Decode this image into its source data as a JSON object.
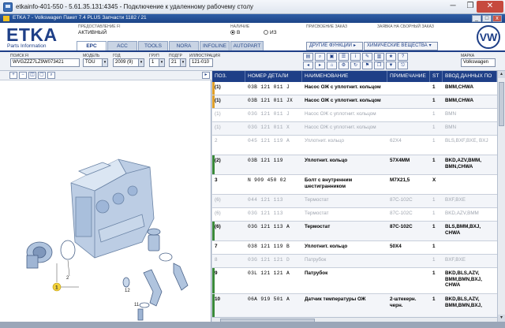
{
  "rdp": {
    "title": "etkainfo-401-550 - 5.61.35.131:4345 - Подключение к удаленному рабочему столу",
    "minimize": "─",
    "restore": "❐",
    "close": "✕"
  },
  "app": {
    "title": "ETKA 7 - Volkswagen Пакет 7.4 PLUS Запчасти 1182 / 21",
    "min": "_",
    "max": "□",
    "close": "x"
  },
  "header": {
    "logo": "ETKA",
    "logo_sub": "Parts Information",
    "order_label": "ПРЕДОСТАВЛЕНИЕ FI",
    "order_value": "АКТИВНЫЙ",
    "availability_label": "НАЛИЧИЕ",
    "avail_b": "В",
    "avail_iz": "ИЗ",
    "assign_label": "ПРИСВОЕНИЕ ЗАКАЗ",
    "collect_label": "ЗАЯВКА НА СБОРНЫЙ ЗАКАЗ",
    "brand_logo": "VW",
    "brand_label": "МАРКА",
    "brand_value": "Volkswagen",
    "other_functions": "ДРУГИЕ ФУНКЦИИ",
    "chemicals": "ХИМИЧЕСКИЕ ВЕЩЕСТВА",
    "tabs": [
      "EPC",
      "ACC",
      "TOOLS",
      "NORA",
      "INFOLINE",
      "AUTOPART"
    ]
  },
  "filter": {
    "fi_label": "ПОИСК FI",
    "fi_value": "WVGZZZ7LZ9W073421",
    "model_label": "МОДЕЛЬ",
    "model_value": "TOU",
    "year_label": "ГОД",
    "year_value": "2009 (9)",
    "group_label": "ГРУП",
    "group_value": "1",
    "subgroup_label": "ПОДГР",
    "subgroup_value": "21",
    "illustration_label": "ИЛЛЮСТРАЦИЯ",
    "illustration_value": "121-010"
  },
  "table": {
    "headers": [
      "ПОЗ.",
      "НОМЕР ДЕТАЛИ",
      "НАИМЕНОВАНИЕ",
      "ПРИМЕЧАНИЕ",
      "ST",
      "ВВОД ДАННЫХ ПО"
    ],
    "rows": [
      {
        "pos": "(1)",
        "part": "03B 121 011 J",
        "name": "Насос ОЖ с уплотнит. кольцом",
        "note": "",
        "st": "1",
        "data": "BMM,CHWA",
        "grey": false,
        "marker": "#e0a02a"
      },
      {
        "pos": "(1)",
        "part": "03B 121 011 JX",
        "name": "Насос ОЖ с уплотнит. кольцом",
        "note": "",
        "st": "1",
        "data": "BMM,CHWA",
        "grey": false,
        "marker": "#e0a02a"
      },
      {
        "pos": "(1)",
        "part": "03G 121 011 J",
        "name": "Насос ОЖ с уплотнит. кольцом",
        "note": "",
        "st": "1",
        "data": "BMN",
        "grey": true,
        "marker": ""
      },
      {
        "pos": "(1)",
        "part": "03G 121 011 X",
        "name": "Насос ОЖ с уплотнит. кольцом",
        "note": "",
        "st": "1",
        "data": "BMN",
        "grey": true,
        "marker": ""
      },
      {
        "pos": "2",
        "part": "045 121 119 A",
        "name": "Уплотнит. кольцо",
        "note": "62X4",
        "st": "1",
        "data": "BLS,BXF,BXE, BXJ",
        "grey": true,
        "marker": ""
      },
      {
        "pos": "(2)",
        "part": "03B 121 119",
        "name": "Уплотнит. кольцо",
        "note": "57X4MM",
        "st": "1",
        "data": "BKD,AZV,BMM, BMN,CHWA",
        "grey": false,
        "marker": "#3a8a3a"
      },
      {
        "pos": "3",
        "part": "N 909 450 02",
        "name": "Болт с внутренним шестигранником",
        "note": "M7X21,5",
        "st": "X",
        "data": "",
        "grey": false,
        "marker": ""
      },
      {
        "pos": "(6)",
        "part": "044 121 113",
        "name": "Термостат",
        "note": "87C-102C",
        "st": "1",
        "data": "BXF,BXE",
        "grey": true,
        "marker": ""
      },
      {
        "pos": "(6)",
        "part": "03G 121 113",
        "name": "Термостат",
        "note": "87C-102C",
        "st": "1",
        "data": "BKD,AZV,BMM",
        "grey": true,
        "marker": ""
      },
      {
        "pos": "(6)",
        "part": "03G 121 113 A",
        "name": "Термостат",
        "note": "87C-102C",
        "st": "1",
        "data": "BLS,BMM,BXJ, CHWA",
        "grey": false,
        "marker": "#3a8a3a"
      },
      {
        "pos": "7",
        "part": "038 121 119 B",
        "name": "Уплотнит. кольцо",
        "note": "50X4",
        "st": "1",
        "data": "",
        "grey": false,
        "marker": ""
      },
      {
        "pos": "8",
        "part": "03G 121 121 D",
        "name": "Патрубок",
        "note": "",
        "st": "1",
        "data": "BXF,BXE",
        "grey": true,
        "marker": ""
      },
      {
        "pos": "9",
        "part": "03L 121 121 A",
        "name": "Патрубок",
        "note": "",
        "st": "1",
        "data": "BKD,BLS,AZV, BMM,BMN,BXJ, CHWA",
        "grey": false,
        "marker": "#3a8a3a"
      },
      {
        "pos": "10",
        "part": "06A 919 501 A",
        "name": "Датчик температуры ОЖ",
        "note": "2-штекерн. черн.",
        "st": "1",
        "data": "BKD,BLS,AZV, BMM,BMN,BXJ,",
        "grey": false,
        "marker": "#3a8a3a"
      }
    ]
  },
  "illustration": {
    "callouts": [
      "1",
      "2",
      "3",
      "4",
      "5",
      "6",
      "7",
      "8",
      "9",
      "10",
      "11",
      "12"
    ]
  }
}
